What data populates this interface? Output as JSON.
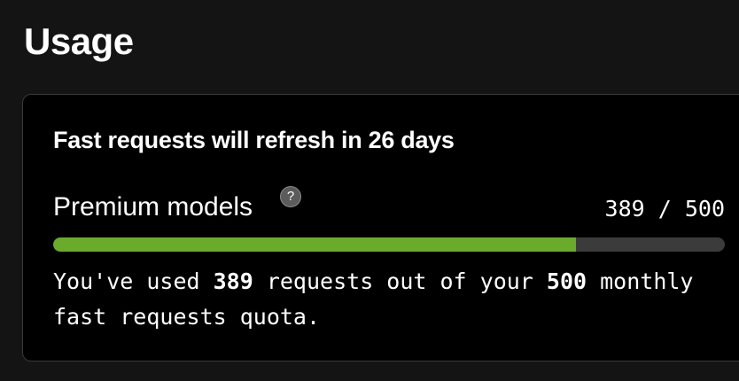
{
  "page": {
    "title": "Usage"
  },
  "usage_card": {
    "heading": "Fast requests will refresh in 26 days",
    "model_label": "Premium models",
    "help_icon_glyph": "?",
    "help_icon": "question-mark-icon",
    "used": "389",
    "limit": "500",
    "count_separator": " / ",
    "progress_fraction": 0.778,
    "progress_color": "#6aaa2c",
    "track_color": "#3b3b3b",
    "description_prefix": "You've used ",
    "description_mid": " requests out of your ",
    "description_suffix": " monthly fast requests quota."
  }
}
